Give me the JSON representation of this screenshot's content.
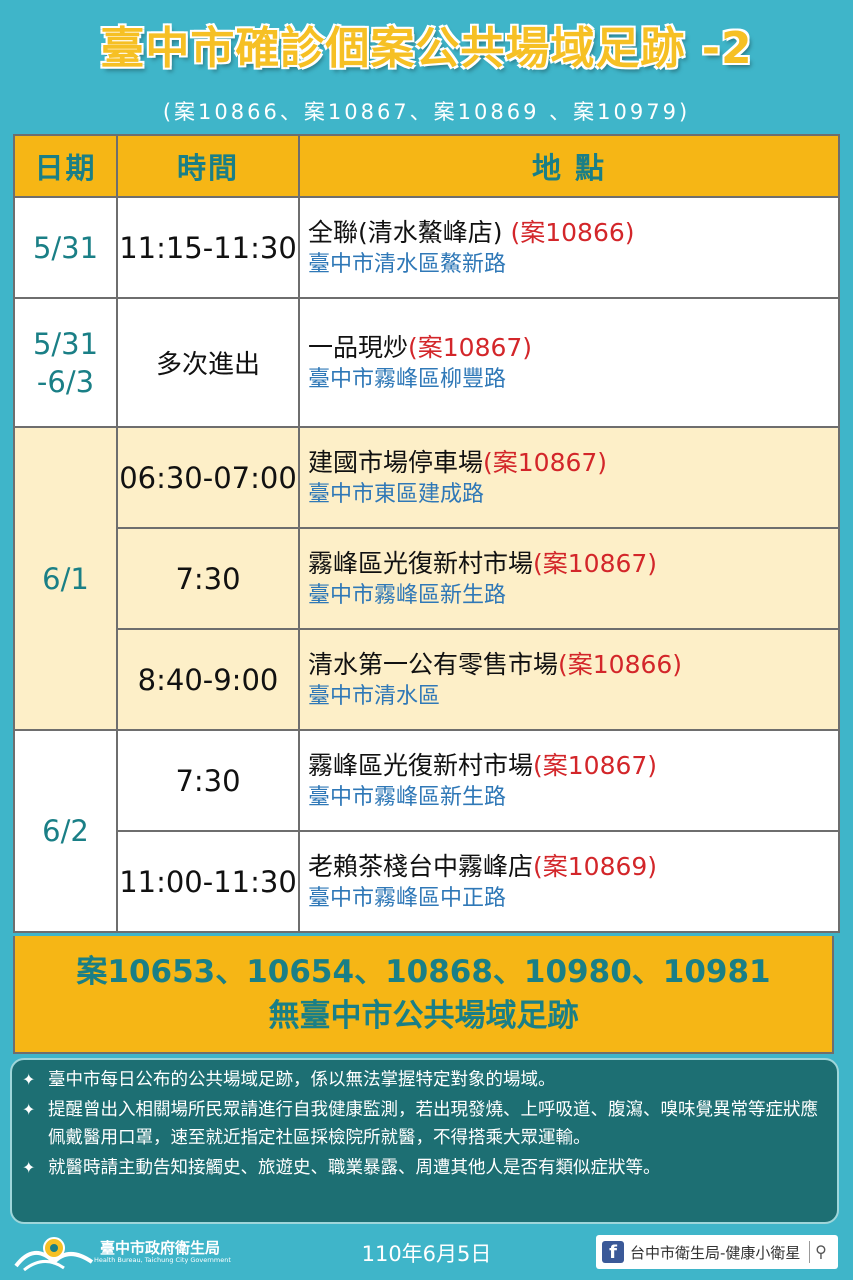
{
  "title": "臺中市確診個案公共場域足跡 -2",
  "subtitle": "(案10866、案10867、案10869 、案10979)",
  "table": {
    "headers": [
      "日期",
      "時間",
      "地 點"
    ],
    "rows": [
      {
        "date": "5/31",
        "time": "11:15-11:30",
        "place": "全聯(清水鰲峰店) ",
        "case": "(案10866)",
        "address": "臺中市清水區鰲新路"
      },
      {
        "date": "5/31\n-6/3",
        "time": "多次進出",
        "place": "一品現炒",
        "case": "(案10867)",
        "address": "臺中市霧峰區柳豐路"
      },
      {
        "date": "6/1",
        "time": "06:30-07:00",
        "place": "建國市場停車場",
        "case": "(案10867)",
        "address": "臺中市東區建成路"
      },
      {
        "date": "",
        "time": "7:30",
        "place": "霧峰區光復新村市場",
        "case": "(案10867)",
        "address": "臺中市霧峰區新生路"
      },
      {
        "date": "",
        "time": "8:40-9:00",
        "place": "清水第一公有零售市場",
        "case": "(案10866)",
        "address": "臺中市清水區"
      },
      {
        "date": "6/2",
        "time": "7:30",
        "place": "霧峰區光復新村市場",
        "case": "(案10867)",
        "address": "臺中市霧峰區新生路"
      },
      {
        "date": "",
        "time": "11:00-11:30",
        "place": "老賴茶棧台中霧峰店",
        "case": "(案10869)",
        "address": "臺中市霧峰區中正路"
      }
    ]
  },
  "notice": {
    "line1": "案10653、10654、10868、10980、10981",
    "line2": "無臺中市公共場域足跡"
  },
  "notes": [
    "臺中市每日公布的公共場域足跡，係以無法掌握特定對象的場域。",
    "提醒曾出入相關場所民眾請進行自我健康監測，若出現發燒、上呼吸道、腹瀉、嗅味覺異常等症狀應佩戴醫用口罩，速至就近指定社區採檢院所就醫，不得搭乘大眾運輸。",
    "就醫時請主動告知接觸史、旅遊史、職業暴露、周遭其他人是否有類似症狀等。"
  ],
  "footer": {
    "org_name": "臺中市政府衛生局",
    "org_en": "Health Bureau, Taichung City Government",
    "date": "110年6月5日",
    "fb_label": "台中市衛生局-健康小衛星"
  },
  "colors": {
    "background": "#3fb5c9",
    "header": "#f6b615",
    "teal_text": "#1a7f86",
    "case_red": "#d3262a",
    "address_blue": "#2f78b7",
    "notes_bg": "#1d6f73"
  }
}
